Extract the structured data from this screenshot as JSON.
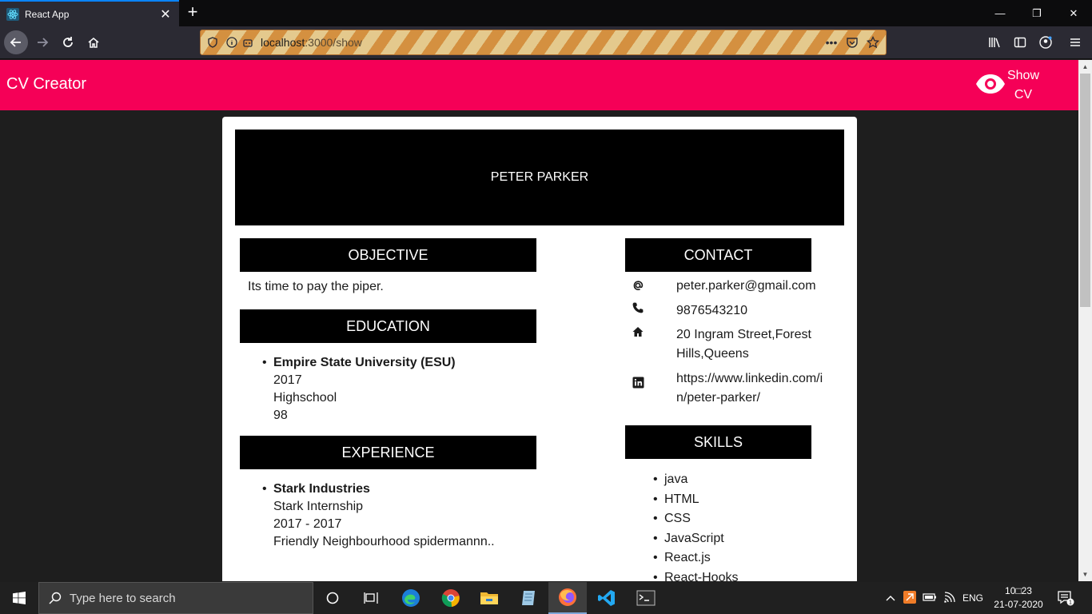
{
  "browser": {
    "tab_title": "React App",
    "tab_close": "✕",
    "new_tab": "+",
    "url_host": "localhost",
    "url_path": ":3000/show",
    "window_controls": [
      "—",
      "❐",
      "✕"
    ]
  },
  "app": {
    "title": "CV Creator",
    "show_cv_label": "Show CV",
    "accent_color": "#f50057"
  },
  "cv": {
    "name": "PETER PARKER",
    "objective": {
      "heading": "OBJECTIVE",
      "text": "Its time to pay the piper."
    },
    "education": {
      "heading": "EDUCATION",
      "items": [
        {
          "institution": "Empire State University (ESU)",
          "year": "2017",
          "level": "Highschool",
          "score": "98"
        }
      ]
    },
    "experience": {
      "heading": "EXPERIENCE",
      "items": [
        {
          "company": "Stark Industries",
          "role": "Stark Internship",
          "period": "2017 - 2017",
          "description": "Friendly Neighbourhood spidermannn.."
        }
      ]
    },
    "contact": {
      "heading": "CONTACT",
      "email": "peter.parker@gmail.com",
      "phone": "9876543210",
      "address": "20 Ingram Street,Forest Hills,Queens",
      "linkedin": "https://www.linkedin.com/in/peter-parker/"
    },
    "skills": {
      "heading": "SKILLS",
      "items": [
        "java",
        "HTML",
        "CSS",
        "JavaScript",
        "React.js",
        "React-Hooks"
      ]
    }
  },
  "taskbar": {
    "search_placeholder": "Type here to search",
    "language": "ENG",
    "time": "10□23",
    "date": "21-07-2020"
  }
}
